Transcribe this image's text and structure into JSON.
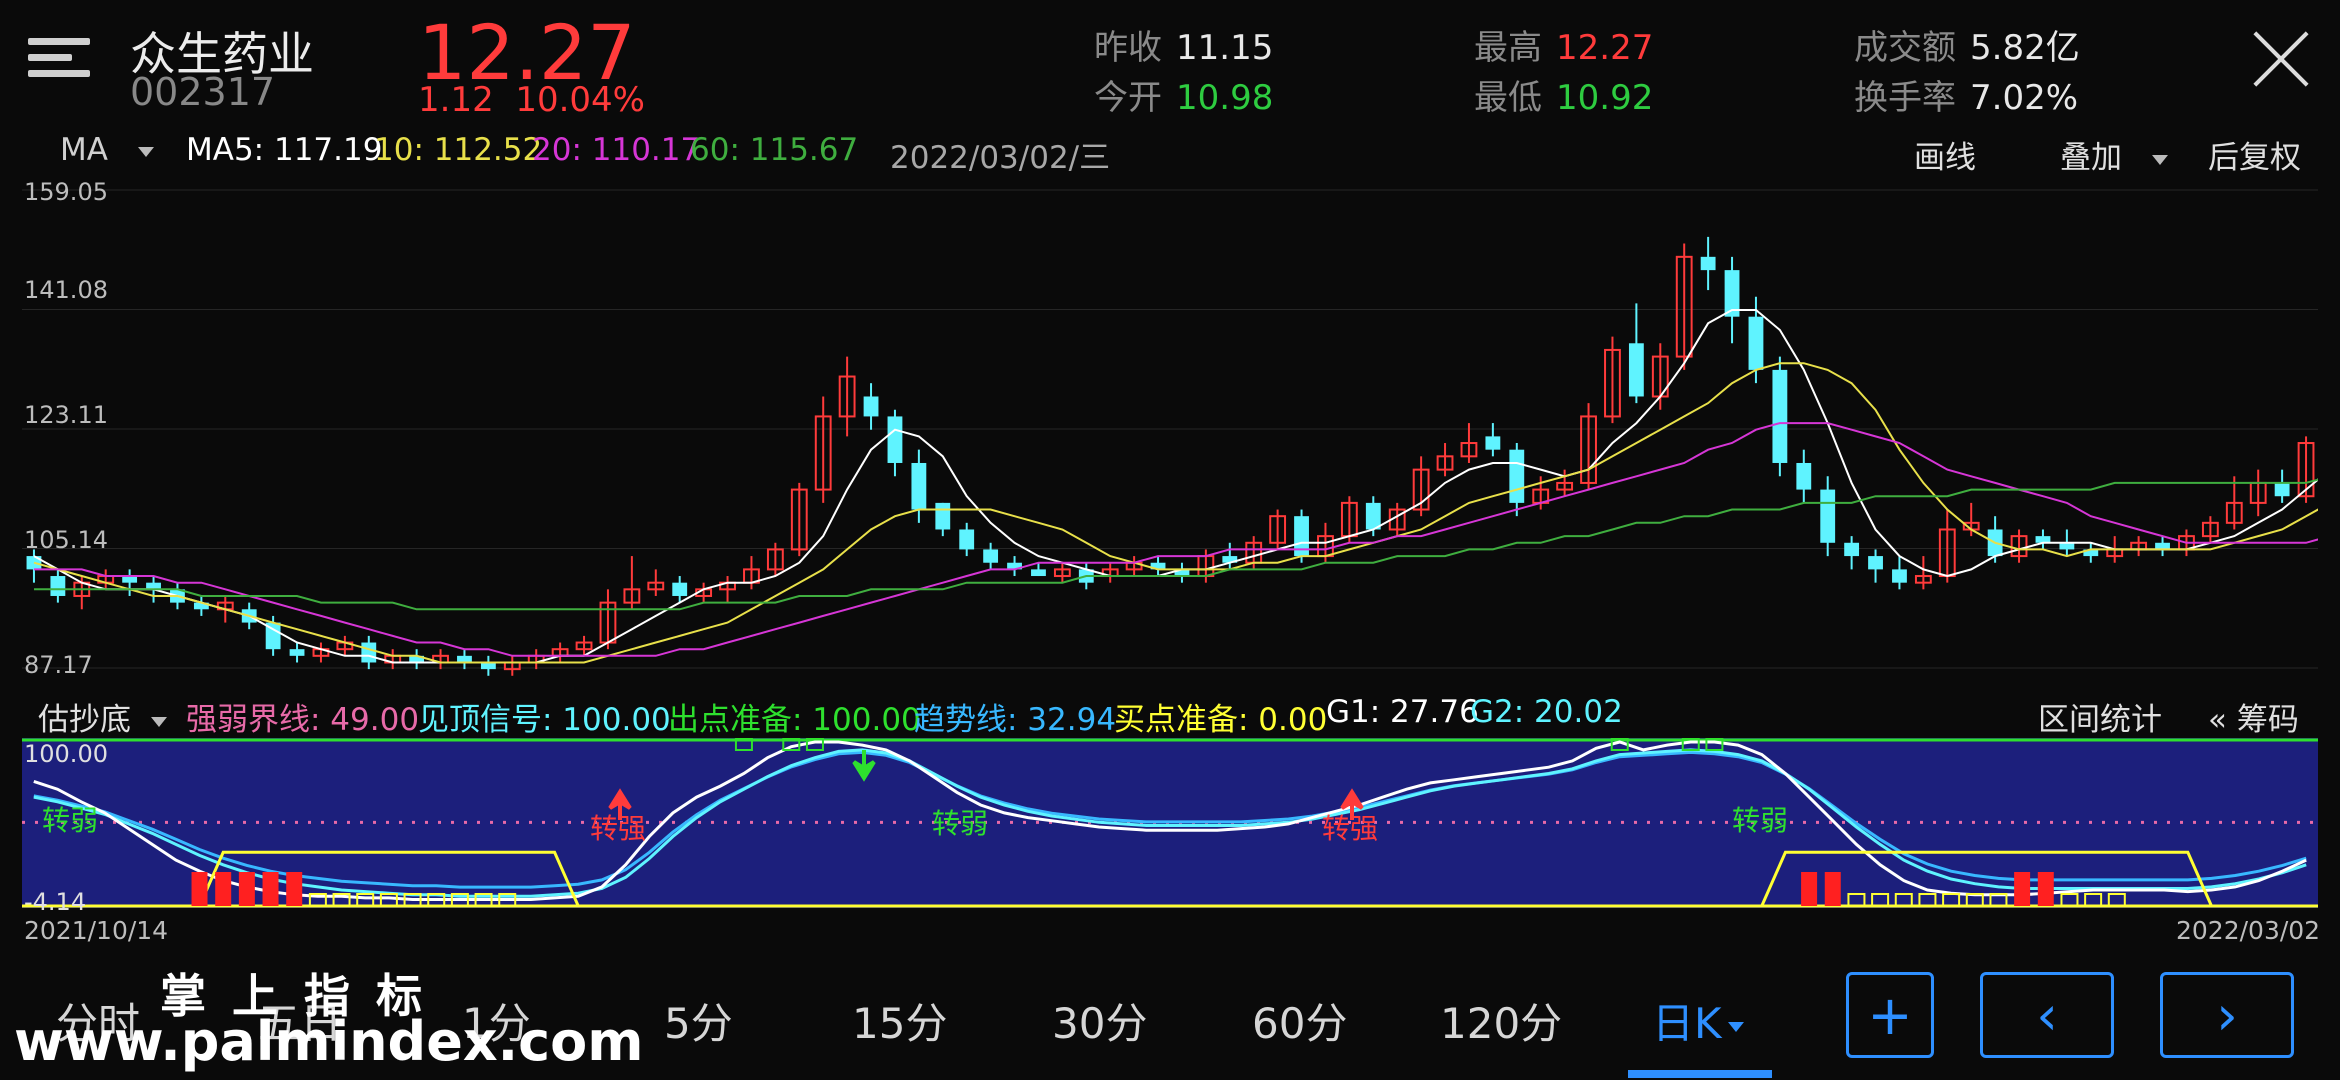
{
  "header": {
    "name": "众生药业",
    "code": "002317",
    "price": "12.27",
    "change": "1.12",
    "change_pct": "10.04%",
    "stats": [
      {
        "label": "昨收",
        "value": "11.15",
        "color": "#e8e8e8"
      },
      {
        "label": "今开",
        "value": "10.98",
        "color": "#2ecc40"
      },
      {
        "label": "最高",
        "value": "12.27",
        "color": "#ff3b3b"
      },
      {
        "label": "最低",
        "value": "10.92",
        "color": "#2ecc40"
      },
      {
        "label": "成交额",
        "value": "5.82亿",
        "color": "#e8e8e8"
      },
      {
        "label": "换手率",
        "value": "7.02%",
        "color": "#e8e8e8"
      }
    ]
  },
  "ma_row": {
    "selector": "MA",
    "ma5": "MA5: 117.19",
    "ma10": "10: 112.52",
    "ma20": "20: 110.17",
    "ma60": "60: 115.67",
    "date": "2022/03/02/三",
    "draw": "画线",
    "overlay": "叠加",
    "adjust": "后复权"
  },
  "colors": {
    "up": "#ff3b3b",
    "down": "#5ff3ff",
    "ma5": "#ffffff",
    "ma10": "#e8e04a",
    "ma20": "#d636d6",
    "ma60": "#3fae3f",
    "ind_bg": "#1c1f7c"
  },
  "main_axis": [
    "159.05",
    "141.08",
    "123.11",
    "105.14",
    "87.17"
  ],
  "indicator_row": {
    "selector": "估抄底",
    "items": [
      {
        "text": "强弱界线: 49.00",
        "color": "#e76aa8"
      },
      {
        "text": "见顶信号: 100.00",
        "color": "#5ff3ff"
      },
      {
        "text": "出点准备: 100.00",
        "color": "#2ee02e"
      },
      {
        "text": "趋势线: 32.94",
        "color": "#38b8ff"
      },
      {
        "text": "买点准备: 0.00",
        "color": "#ffff33"
      },
      {
        "text": "G1: 27.76",
        "color": "#ffffff"
      },
      {
        "text": "G2: 20.02",
        "color": "#5ff3ff"
      }
    ],
    "range_stats": "区间统计",
    "chips": "« 筹码"
  },
  "ind_axis": {
    "top": "100.00",
    "bottom": "-4.14"
  },
  "ind_labels": {
    "weak": "转弱",
    "strong": "转强"
  },
  "dates": {
    "start": "2021/10/14",
    "end": "2022/03/02"
  },
  "periods": [
    "分时",
    "五日",
    "1分",
    "5分",
    "15分",
    "30分",
    "60分",
    "120分",
    "日K"
  ],
  "nav": {
    "add": "+",
    "prev": "‹",
    "next": "›"
  },
  "watermark": {
    "title": "掌上指标",
    "url": "www.palmindex.com"
  },
  "chart_data": {
    "type": "candlestick",
    "x_range": [
      "2021/10/14",
      "2022/03/02"
    ],
    "ylim": [
      87.17,
      159.05
    ],
    "candles": [
      [
        104,
        102,
        105,
        100
      ],
      [
        101,
        98,
        102,
        97
      ],
      [
        98,
        100,
        101,
        96
      ],
      [
        100,
        101,
        102,
        99
      ],
      [
        101,
        100,
        102,
        98
      ],
      [
        100,
        99,
        101,
        97
      ],
      [
        99,
        97,
        100,
        96
      ],
      [
        97,
        96,
        98,
        95
      ],
      [
        96,
        97,
        98,
        94
      ],
      [
        96,
        94,
        97,
        93
      ],
      [
        94,
        90,
        95,
        89
      ],
      [
        90,
        89,
        91,
        88
      ],
      [
        89,
        90,
        91,
        88
      ],
      [
        90,
        91,
        92,
        89
      ],
      [
        91,
        88,
        92,
        87
      ],
      [
        88,
        89,
        90,
        87
      ],
      [
        89,
        88,
        90,
        87
      ],
      [
        88,
        89,
        90,
        87
      ],
      [
        89,
        88,
        90,
        87
      ],
      [
        88,
        87,
        89,
        86
      ],
      [
        87,
        88,
        89,
        86
      ],
      [
        88,
        89,
        90,
        87
      ],
      [
        89,
        90,
        91,
        88
      ],
      [
        90,
        91,
        92,
        89
      ],
      [
        91,
        97,
        99,
        90
      ],
      [
        97,
        99,
        104,
        96
      ],
      [
        99,
        100,
        102,
        98
      ],
      [
        100,
        98,
        101,
        97
      ],
      [
        98,
        99,
        100,
        97
      ],
      [
        99,
        100,
        101,
        97
      ],
      [
        100,
        102,
        104,
        99
      ],
      [
        102,
        105,
        106,
        101
      ],
      [
        105,
        114,
        115,
        104
      ],
      [
        114,
        125,
        128,
        112
      ],
      [
        125,
        131,
        134,
        122
      ],
      [
        128,
        125,
        130,
        123
      ],
      [
        125,
        118,
        126,
        116
      ],
      [
        118,
        111,
        120,
        109
      ],
      [
        112,
        108,
        112,
        107
      ],
      [
        108,
        105,
        109,
        104
      ],
      [
        105,
        103,
        106,
        102
      ],
      [
        103,
        102,
        104,
        101
      ],
      [
        102,
        101,
        103,
        101
      ],
      [
        101,
        102,
        103,
        100
      ],
      [
        102,
        100,
        103,
        99
      ],
      [
        101,
        102,
        103,
        100
      ],
      [
        102,
        103,
        104,
        101
      ],
      [
        103,
        102,
        104,
        101
      ],
      [
        102,
        101,
        103,
        100
      ],
      [
        101,
        104,
        105,
        100
      ],
      [
        104,
        103,
        106,
        102
      ],
      [
        103,
        106,
        107,
        102
      ],
      [
        106,
        110,
        111,
        105
      ],
      [
        110,
        104,
        111,
        103
      ],
      [
        104,
        107,
        109,
        103
      ],
      [
        107,
        112,
        113,
        106
      ],
      [
        112,
        108,
        113,
        107
      ],
      [
        108,
        111,
        112,
        107
      ],
      [
        111,
        117,
        119,
        110
      ],
      [
        117,
        119,
        121,
        116
      ],
      [
        119,
        121,
        124,
        118
      ],
      [
        122,
        120,
        124,
        119
      ],
      [
        120,
        112,
        121,
        110
      ],
      [
        112,
        114,
        116,
        111
      ],
      [
        114,
        115,
        117,
        113
      ],
      [
        115,
        125,
        127,
        114
      ],
      [
        125,
        135,
        137,
        124
      ],
      [
        136,
        128,
        142,
        127
      ],
      [
        128,
        134,
        136,
        126
      ],
      [
        134,
        149,
        151,
        132
      ],
      [
        149,
        147,
        152,
        144
      ],
      [
        147,
        140,
        149,
        136
      ],
      [
        140,
        132,
        143,
        130
      ],
      [
        132,
        118,
        134,
        116
      ],
      [
        118,
        114,
        120,
        112
      ],
      [
        114,
        106,
        116,
        104
      ],
      [
        106,
        104,
        107,
        102
      ],
      [
        104,
        102,
        105,
        100
      ],
      [
        102,
        100,
        104,
        99
      ],
      [
        100,
        101,
        104,
        99
      ],
      [
        101,
        108,
        111,
        100
      ],
      [
        108,
        109,
        112,
        107
      ],
      [
        108,
        104,
        110,
        103
      ],
      [
        104,
        107,
        108,
        103
      ],
      [
        107,
        106,
        108,
        105
      ],
      [
        106,
        105,
        108,
        104
      ],
      [
        105,
        104,
        106,
        103
      ],
      [
        104,
        105,
        107,
        103
      ],
      [
        105,
        106,
        107,
        104
      ],
      [
        106,
        105,
        107,
        104
      ],
      [
        105,
        107,
        108,
        104
      ],
      [
        107,
        109,
        110,
        106
      ],
      [
        109,
        112,
        116,
        108
      ],
      [
        112,
        115,
        117,
        110
      ],
      [
        115,
        113,
        117,
        112
      ],
      [
        113,
        121,
        122,
        112
      ]
    ],
    "ma_series": [
      {
        "name": "MA5",
        "values": [
          104,
          102,
          100,
          99,
          99,
          99,
          98,
          97,
          96,
          95,
          93,
          91,
          90,
          89,
          89,
          88,
          88,
          88,
          88,
          88,
          88,
          88,
          89,
          89,
          91,
          93,
          95,
          97,
          99,
          100,
          100,
          101,
          103,
          107,
          114,
          120,
          123,
          122,
          119,
          113,
          109,
          106,
          104,
          103,
          102,
          101,
          101,
          101,
          102,
          102,
          103,
          104,
          105,
          106,
          106,
          107,
          108,
          110,
          112,
          115,
          117,
          118,
          118,
          117,
          116,
          117,
          121,
          124,
          128,
          133,
          139,
          141,
          141,
          138,
          132,
          124,
          115,
          108,
          104,
          102,
          101,
          102,
          104,
          105,
          106,
          106,
          106,
          105,
          105,
          105,
          105,
          106,
          107,
          109,
          111,
          114,
          117
        ]
      },
      {
        "name": "MA10",
        "values": [
          103,
          102,
          101,
          100,
          99,
          98,
          98,
          97,
          96,
          95,
          94,
          93,
          92,
          91,
          90,
          89,
          89,
          88,
          88,
          88,
          88,
          88,
          88,
          88,
          89,
          90,
          91,
          92,
          93,
          94,
          96,
          98,
          100,
          102,
          105,
          108,
          110,
          111,
          111,
          111,
          111,
          110,
          109,
          108,
          106,
          104,
          103,
          102,
          102,
          102,
          102,
          103,
          103,
          104,
          104,
          105,
          106,
          107,
          108,
          110,
          112,
          113,
          114,
          115,
          116,
          117,
          119,
          121,
          123,
          125,
          127,
          130,
          132,
          133,
          133,
          132,
          130,
          126,
          120,
          115,
          111,
          108,
          106,
          105,
          105,
          104,
          105,
          105,
          105,
          105,
          105,
          105,
          106,
          107,
          108,
          110,
          112
        ]
      },
      {
        "name": "MA20",
        "values": [
          102,
          102,
          102,
          101,
          101,
          101,
          100,
          100,
          99,
          98,
          97,
          96,
          95,
          94,
          93,
          92,
          91,
          91,
          90,
          90,
          89,
          89,
          89,
          89,
          89,
          89,
          89,
          90,
          90,
          91,
          92,
          93,
          94,
          95,
          96,
          97,
          98,
          99,
          100,
          101,
          102,
          102,
          103,
          103,
          103,
          103,
          103,
          104,
          104,
          104,
          105,
          105,
          105,
          105,
          105,
          106,
          106,
          107,
          107,
          108,
          109,
          110,
          111,
          112,
          113,
          114,
          115,
          116,
          117,
          118,
          120,
          121,
          123,
          124,
          124,
          124,
          123,
          122,
          121,
          119,
          117,
          116,
          115,
          114,
          113,
          112,
          110,
          109,
          108,
          107,
          106,
          106,
          106,
          106,
          106,
          106,
          107
        ]
      },
      {
        "name": "MA60",
        "values": [
          99,
          99,
          99,
          99,
          99,
          99,
          99,
          98,
          98,
          98,
          98,
          98,
          97,
          97,
          97,
          97,
          96,
          96,
          96,
          96,
          96,
          96,
          96,
          96,
          96,
          96,
          96,
          96,
          97,
          97,
          97,
          97,
          98,
          98,
          98,
          99,
          99,
          99,
          99,
          100,
          100,
          100,
          100,
          100,
          101,
          101,
          101,
          101,
          101,
          101,
          102,
          102,
          102,
          102,
          103,
          103,
          103,
          104,
          104,
          104,
          105,
          105,
          106,
          106,
          107,
          107,
          108,
          109,
          109,
          110,
          110,
          111,
          111,
          111,
          112,
          112,
          112,
          113,
          113,
          113,
          113,
          114,
          114,
          114,
          114,
          114,
          114,
          115,
          115,
          115,
          115,
          115,
          115,
          115,
          115,
          115,
          116
        ]
      }
    ],
    "indicator": {
      "ylim": [
        -4.14,
        100.0
      ],
      "threshold": 49.0,
      "G1": [
        75,
        70,
        62,
        55,
        45,
        35,
        25,
        18,
        12,
        8,
        5,
        3,
        2,
        2,
        1,
        1,
        0,
        0,
        0,
        0,
        0,
        0,
        1,
        2,
        8,
        22,
        40,
        55,
        65,
        72,
        80,
        90,
        97,
        100,
        100,
        98,
        95,
        88,
        78,
        68,
        60,
        55,
        52,
        50,
        48,
        46,
        45,
        44,
        44,
        44,
        44,
        45,
        46,
        48,
        52,
        56,
        60,
        65,
        70,
        74,
        76,
        78,
        80,
        82,
        84,
        88,
        96,
        100,
        95,
        98,
        100,
        100,
        98,
        92,
        80,
        65,
        50,
        35,
        22,
        12,
        6,
        4,
        3,
        3,
        3,
        4,
        5,
        6,
        6,
        6,
        6,
        5,
        6,
        8,
        12,
        18,
        25
      ],
      "G2": [
        65,
        62,
        58,
        54,
        48,
        42,
        35,
        28,
        22,
        17,
        13,
        10,
        8,
        6,
        5,
        4,
        3,
        3,
        2,
        2,
        2,
        2,
        3,
        4,
        7,
        14,
        26,
        40,
        52,
        62,
        70,
        78,
        85,
        90,
        94,
        95,
        93,
        88,
        80,
        72,
        65,
        60,
        56,
        53,
        51,
        49,
        48,
        47,
        47,
        47,
        47,
        47,
        48,
        49,
        51,
        54,
        57,
        61,
        65,
        69,
        72,
        74,
        76,
        78,
        80,
        83,
        88,
        92,
        93,
        94,
        95,
        94,
        92,
        88,
        80,
        70,
        58,
        46,
        35,
        25,
        18,
        13,
        10,
        8,
        7,
        7,
        7,
        7,
        7,
        7,
        7,
        7,
        8,
        10,
        13,
        17,
        22
      ]
    }
  }
}
